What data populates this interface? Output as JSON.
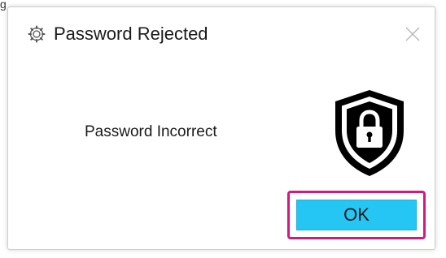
{
  "dialog": {
    "title": "Password Rejected",
    "message": "Password Incorrect",
    "ok_label": "OK",
    "icons": {
      "app": "gear-icon",
      "close": "close-icon",
      "status": "shield-lock-icon"
    }
  },
  "colors": {
    "ok_button": "#25c6f3",
    "highlight": "#d6187a",
    "shield": "#000000"
  }
}
